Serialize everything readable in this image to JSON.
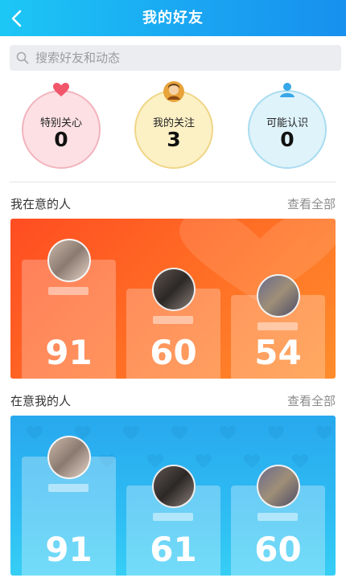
{
  "header": {
    "title": "我的好友",
    "back_icon": "chevron-left-icon"
  },
  "search": {
    "placeholder": "搜索好友和动态",
    "icon": "search-icon"
  },
  "stats": [
    {
      "label": "特别关心",
      "value": "0",
      "icon": "heart-icon"
    },
    {
      "label": "我的关注",
      "value": "3",
      "icon": "avatar-icon"
    },
    {
      "label": "可能认识",
      "value": "0",
      "icon": "person-icon"
    }
  ],
  "sections": {
    "care": {
      "title": "我在意的人",
      "more": "查看全部",
      "scores": [
        "91",
        "60",
        "54"
      ]
    },
    "cared": {
      "title": "在意我的人",
      "more": "查看全部",
      "scores": [
        "91",
        "61",
        "60"
      ]
    }
  },
  "colors": {
    "header": "#1aa6f2",
    "care_panel": "#ff6a24",
    "cared_panel": "#2ebcf3"
  }
}
